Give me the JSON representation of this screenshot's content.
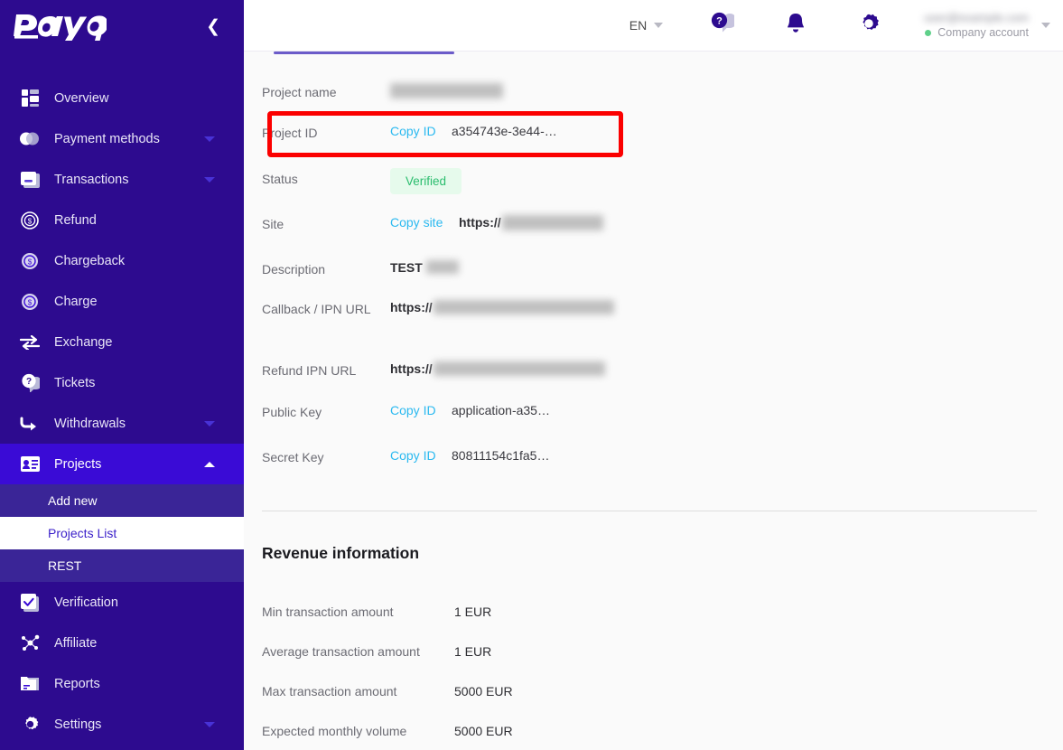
{
  "sidebar": {
    "logo_text": "PayOp",
    "collapse_icon": "chevron-left-icon",
    "items": [
      {
        "label": "Overview",
        "icon": "grid-icon",
        "expandable": false
      },
      {
        "label": "Payment methods",
        "icon": "toggle-icon",
        "expandable": true
      },
      {
        "label": "Transactions",
        "icon": "card-icon",
        "expandable": true
      },
      {
        "label": "Refund",
        "icon": "refund-coin-icon",
        "expandable": false
      },
      {
        "label": "Chargeback",
        "icon": "chargeback-coin-icon",
        "expandable": false
      },
      {
        "label": "Charge",
        "icon": "charge-coin-icon",
        "expandable": false
      },
      {
        "label": "Exchange",
        "icon": "exchange-arrows-icon",
        "expandable": false
      },
      {
        "label": "Tickets",
        "icon": "question-bubble-icon",
        "expandable": false
      },
      {
        "label": "Withdrawals",
        "icon": "arrow-curve-icon",
        "expandable": true
      },
      {
        "label": "Projects",
        "icon": "contact-card-icon",
        "expandable": true,
        "active": true,
        "expanded": true
      },
      {
        "label": "Verification",
        "icon": "checkbox-icon",
        "expandable": false
      },
      {
        "label": "Affiliate",
        "icon": "network-icon",
        "expandable": false
      },
      {
        "label": "Reports",
        "icon": "folder-icon",
        "expandable": false
      },
      {
        "label": "Settings",
        "icon": "gear-icon",
        "expandable": true
      }
    ],
    "projects_subitems": [
      {
        "label": "Add new",
        "selected": false
      },
      {
        "label": "Projects List",
        "selected": true
      },
      {
        "label": "REST",
        "selected": false
      }
    ]
  },
  "topbar": {
    "language": "EN",
    "language_caret": "chevron-down-icon",
    "help_icon": "question-bubble-icon",
    "notifications_icon": "bell-icon",
    "settings_icon": "gear-icon",
    "account_email": "",
    "account_type": "Company account",
    "account_caret": "chevron-down-icon"
  },
  "project_details": {
    "rows": [
      {
        "label": "Project name",
        "type": "redacted",
        "redacted_width": 125
      },
      {
        "label": "Project ID",
        "type": "copy",
        "copy_label": "Copy ID",
        "value": "a354743e-3e44-…",
        "highlighted": true
      },
      {
        "label": "Status",
        "type": "badge",
        "value": "Verified"
      },
      {
        "label": "Site",
        "type": "copy-url",
        "copy_label": "Copy site",
        "value": "https://",
        "redacted_width": 112
      },
      {
        "label": "Description",
        "type": "bold-redacted",
        "value": "TEST",
        "redacted_width": 36
      },
      {
        "label": "Callback / IPN URL",
        "type": "url-redacted",
        "value": "https://",
        "redacted_width": 200
      },
      {
        "label": "Refund IPN URL",
        "type": "url-redacted",
        "value": "https://",
        "redacted_width": 190
      },
      {
        "label": "Public Key",
        "type": "copy",
        "copy_label": "Copy ID",
        "value": "application-a35…"
      },
      {
        "label": "Secret Key",
        "type": "copy",
        "copy_label": "Copy ID",
        "value": "80811154c1fa5…"
      }
    ]
  },
  "revenue": {
    "title": "Revenue information",
    "rows": [
      {
        "label": "Min transaction amount",
        "value": "1 EUR"
      },
      {
        "label": "Average transaction amount",
        "value": "1 EUR"
      },
      {
        "label": "Max transaction amount",
        "value": "5000 EUR"
      },
      {
        "label": "Expected monthly volume",
        "value": "5000 EUR"
      }
    ]
  },
  "colors": {
    "sidebar_bg": "#2d0b8f",
    "sidebar_active": "#3a0bd6",
    "sidebar_sub": "#3a2597",
    "link_blue": "#2ab9f0",
    "badge_green_bg": "#e6faec",
    "badge_green_text": "#2bbd6e",
    "annotation_red": "#fb0000",
    "tab_underline": "#6b5bc9",
    "content_bg": "#fafafa"
  }
}
